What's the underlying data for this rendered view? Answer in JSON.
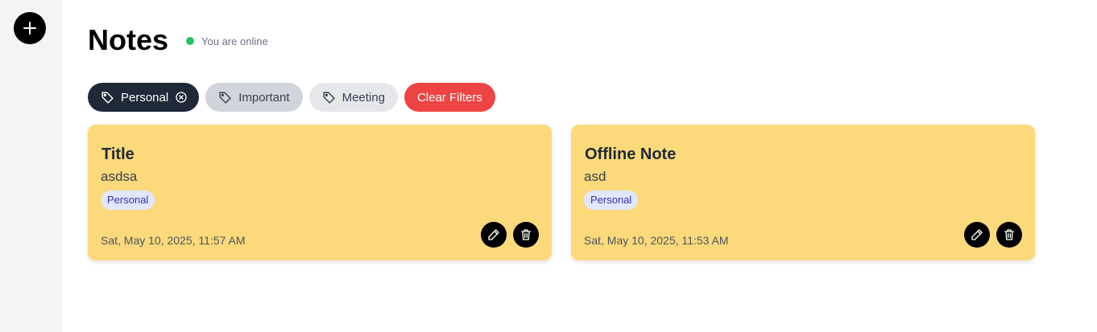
{
  "sidebar": {
    "add_button_icon": "plus-icon"
  },
  "header": {
    "title": "Notes",
    "status_text": "You are online",
    "status_color": "#22c55e"
  },
  "filters": {
    "chips": [
      {
        "label": "Personal",
        "icon": "tag-icon",
        "active": true
      },
      {
        "label": "Important",
        "icon": "tag-icon",
        "active": false
      },
      {
        "label": "Meeting",
        "icon": "tag-icon",
        "active": false
      }
    ],
    "clear_label": "Clear Filters"
  },
  "notes": [
    {
      "title": "Title",
      "body": "asdsa",
      "tag": "Personal",
      "date": "Sat, May 10, 2025, 11:57 AM"
    },
    {
      "title": "Offline Note",
      "body": "asd",
      "tag": "Personal",
      "date": "Sat, May 10, 2025, 11:53 AM"
    }
  ],
  "colors": {
    "card_bg": "#fcd97a",
    "clear_button": "#ef4444",
    "active_chip": "#1f2937"
  }
}
